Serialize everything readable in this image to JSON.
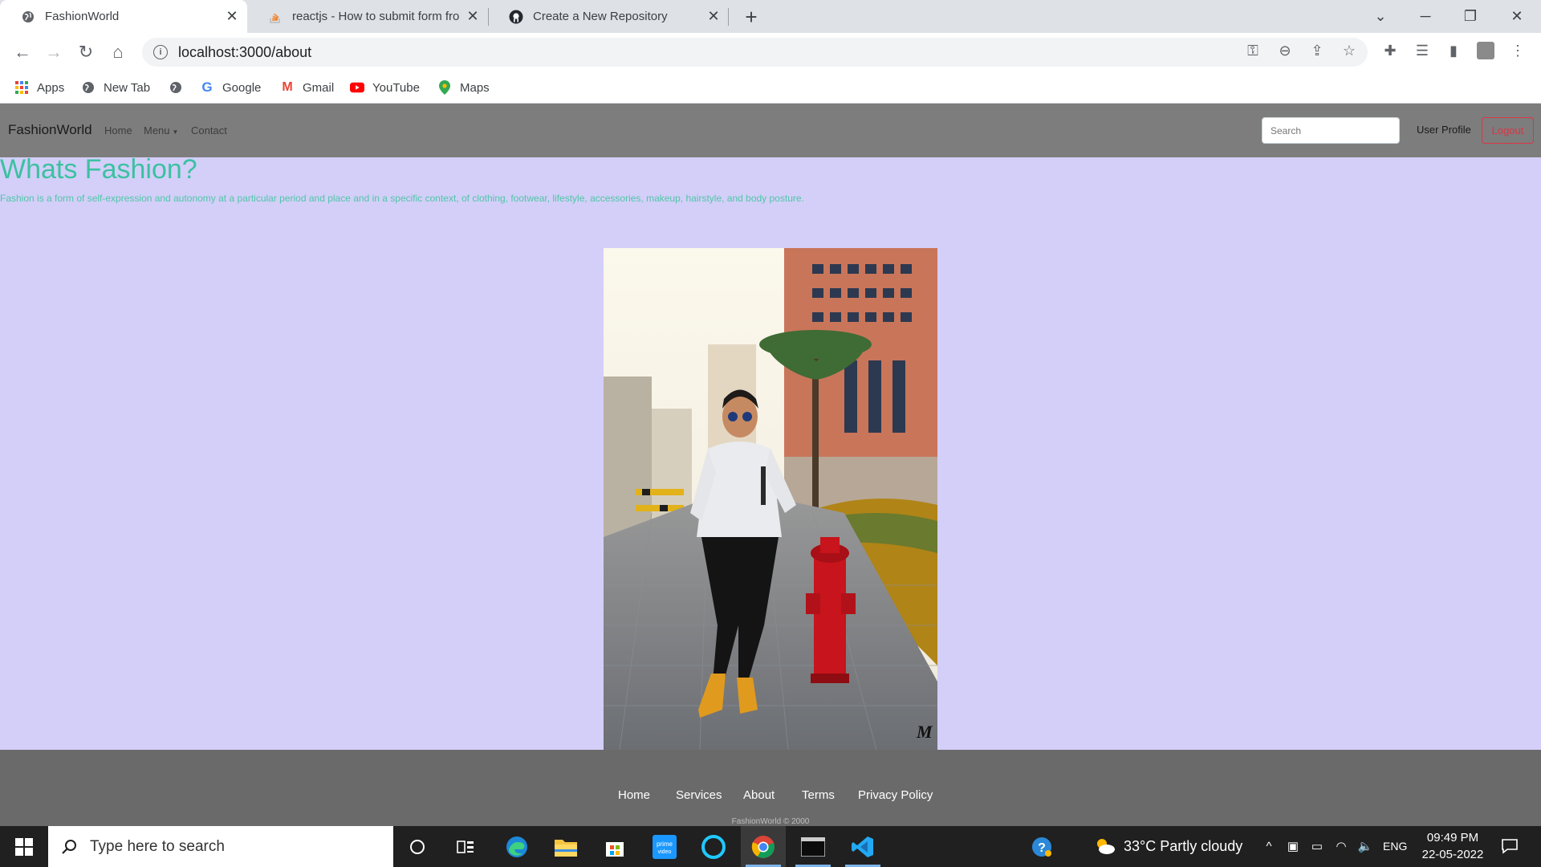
{
  "browser": {
    "tabs": [
      {
        "title": "FashionWorld",
        "icon": "globe-icon",
        "active": true
      },
      {
        "title": "reactjs - How to submit form fro",
        "icon": "stackoverflow-icon",
        "active": false
      },
      {
        "title": "Create a New Repository",
        "icon": "github-icon",
        "active": false
      }
    ],
    "url": "localhost:3000/about",
    "bookmarks": [
      {
        "label": "Apps",
        "icon": "apps-grid-icon"
      },
      {
        "label": "New Tab",
        "icon": "globe-icon"
      },
      {
        "label": "",
        "icon": "globe-icon"
      },
      {
        "label": "Google",
        "icon": "google-icon"
      },
      {
        "label": "Gmail",
        "icon": "gmail-icon"
      },
      {
        "label": "YouTube",
        "icon": "youtube-icon"
      },
      {
        "label": "Maps",
        "icon": "maps-pin-icon"
      }
    ]
  },
  "page": {
    "navbar": {
      "brand": "FashionWorld",
      "links": [
        "Home",
        "Menu",
        "Contact"
      ],
      "search_placeholder": "Search",
      "user_profile": "User Profile",
      "logout": "Logout"
    },
    "hero": {
      "title": "Whats Fashion?",
      "text": "Fashion is a form of self-expression and autonomy at a particular period and place and in a specific context, of clothing, footwear, lifestyle, accessories, makeup, hairstyle, and body posture."
    },
    "photo": {
      "watermark": "M"
    },
    "footer": {
      "links": [
        "Home",
        "Services",
        "About",
        "Terms",
        "Privacy Policy"
      ],
      "copyright": "FashionWorld © 2000"
    }
  },
  "taskbar": {
    "search_placeholder": "Type here to search",
    "weather": "33°C  Partly cloudy",
    "language": "ENG",
    "time": "09:49 PM",
    "date": "22-05-2022"
  },
  "colors": {
    "page_bg": "#d3cff9",
    "navbar_bg": "#7d7d7d",
    "hero_accent": "#3cc1a0",
    "logout_red": "#dc3545",
    "footer_bg": "#6a6a6a",
    "taskbar_bg": "#202020"
  }
}
